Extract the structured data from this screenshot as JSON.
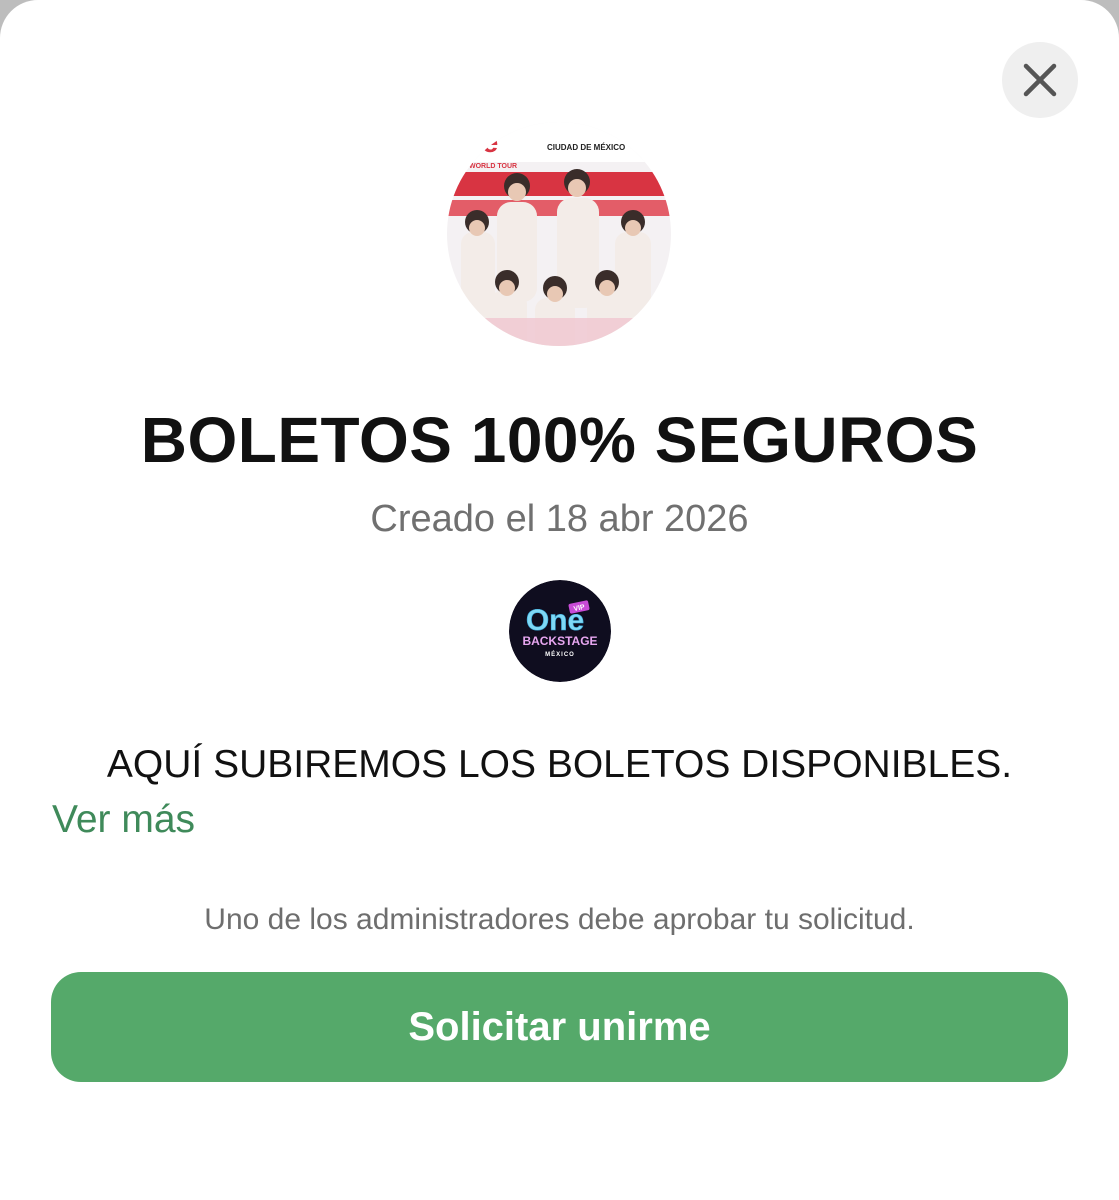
{
  "dialog": {
    "close_icon": "close-icon",
    "title": "BOLETOS 100% SEGUROS",
    "created": "Creado el 18 abr 2026",
    "description": "AQUÍ SUBIREMOS LOS BOLETOS DISPONIBLES.",
    "see_more": "Ver más",
    "approval_note": "Uno de los administradores debe aprobar tu solicitud.",
    "join_button": "Solicitar unirme"
  },
  "group_photo": {
    "poster_lines": [
      "CIUDAD DE MÉXICO",
      "WORLD TOUR"
    ]
  },
  "community_logo": {
    "main": "One",
    "badge": "VIP",
    "line2": "BACKSTAGE",
    "line3": "MÉXICO"
  },
  "colors": {
    "accent": "#55a96a",
    "link": "#3f8a5a",
    "muted": "#707070"
  }
}
